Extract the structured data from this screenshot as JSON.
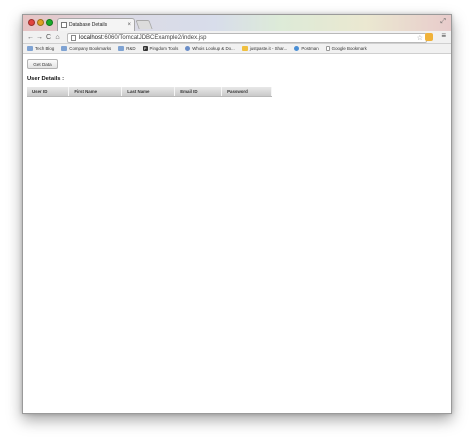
{
  "tab": {
    "title": "Database Details",
    "close_glyph": "×"
  },
  "toolbar": {
    "back_glyph": "←",
    "forward_glyph": "→",
    "reload_glyph": "C",
    "home_glyph": "⌂",
    "url_host": "localhost",
    "url_rest": ":6060/TomcatJDBCExample2/index.jsp",
    "star_glyph": "☆",
    "menu_glyph": "≡"
  },
  "bookmarks": [
    {
      "label": "Tech Blog",
      "icon": "folder-icon"
    },
    {
      "label": "Company Bookmarks",
      "icon": "folder-icon"
    },
    {
      "label": "R&D",
      "icon": "folder-icon"
    },
    {
      "label": "Pingdom Tools",
      "icon": "pingdom-icon"
    },
    {
      "label": "Whois Lookup & Do...",
      "icon": "globe-icon"
    },
    {
      "label": "justpaste.it - Shar...",
      "icon": "justpaste-icon"
    },
    {
      "label": "Postman",
      "icon": "postman-icon"
    },
    {
      "label": "Google Bookmark",
      "icon": "page-icon"
    }
  ],
  "page": {
    "get_data_label": "Get Data",
    "heading": "User Details :",
    "columns": [
      "User ID",
      "First Name",
      "Last Name",
      "Email ID",
      "Password"
    ]
  },
  "colors": {
    "window_border": "#9a9a9a",
    "table_header": "#d4d4d4"
  }
}
